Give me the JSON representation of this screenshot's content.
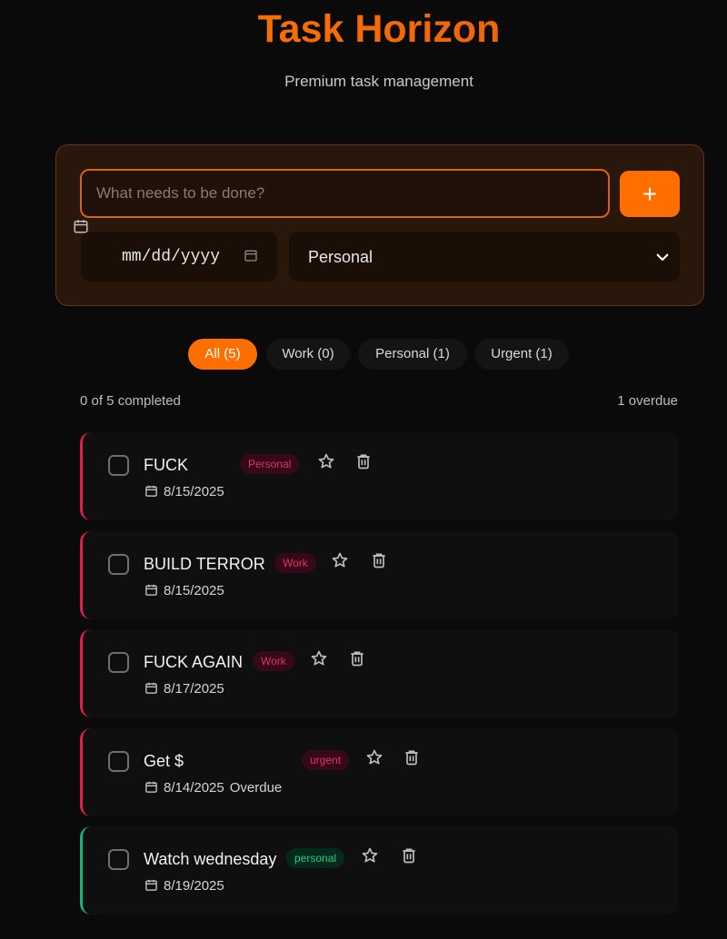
{
  "header": {
    "title": "Task Horizon",
    "subtitle": "Premium task management"
  },
  "add_form": {
    "input_placeholder": "What needs to be done?",
    "add_button_label": "+",
    "date_placeholder": "mm/dd/yyyy",
    "category_value": "Personal"
  },
  "filters": [
    {
      "label": "All (5)",
      "active": true
    },
    {
      "label": "Work (0)",
      "active": false
    },
    {
      "label": "Personal (1)",
      "active": false
    },
    {
      "label": "Urgent (1)",
      "active": false
    }
  ],
  "stats": {
    "completed": "0 of 5 completed",
    "overdue": "1 overdue"
  },
  "tasks": [
    {
      "title": "FUCK",
      "tag": "Personal",
      "date": "8/15/2025",
      "overdue": "",
      "accent": "#e21e4a"
    },
    {
      "title": "BUILD TERROR",
      "tag": "Work",
      "date": "8/15/2025",
      "overdue": "",
      "accent": "#e21e4a"
    },
    {
      "title": "FUCK AGAIN",
      "tag": "Work",
      "date": "8/17/2025",
      "overdue": "",
      "accent": "#e21e4a"
    },
    {
      "title": "Get $",
      "tag": "urgent",
      "date": "8/14/2025",
      "overdue": "Overdue",
      "accent": "#e21e4a"
    },
    {
      "title": "Watch wednesday",
      "tag": "personal",
      "date": "8/19/2025",
      "overdue": "",
      "accent": "#18b374"
    }
  ],
  "colors": {
    "accent": "#ff6f00",
    "danger": "#e21e4a",
    "success": "#18b374"
  }
}
